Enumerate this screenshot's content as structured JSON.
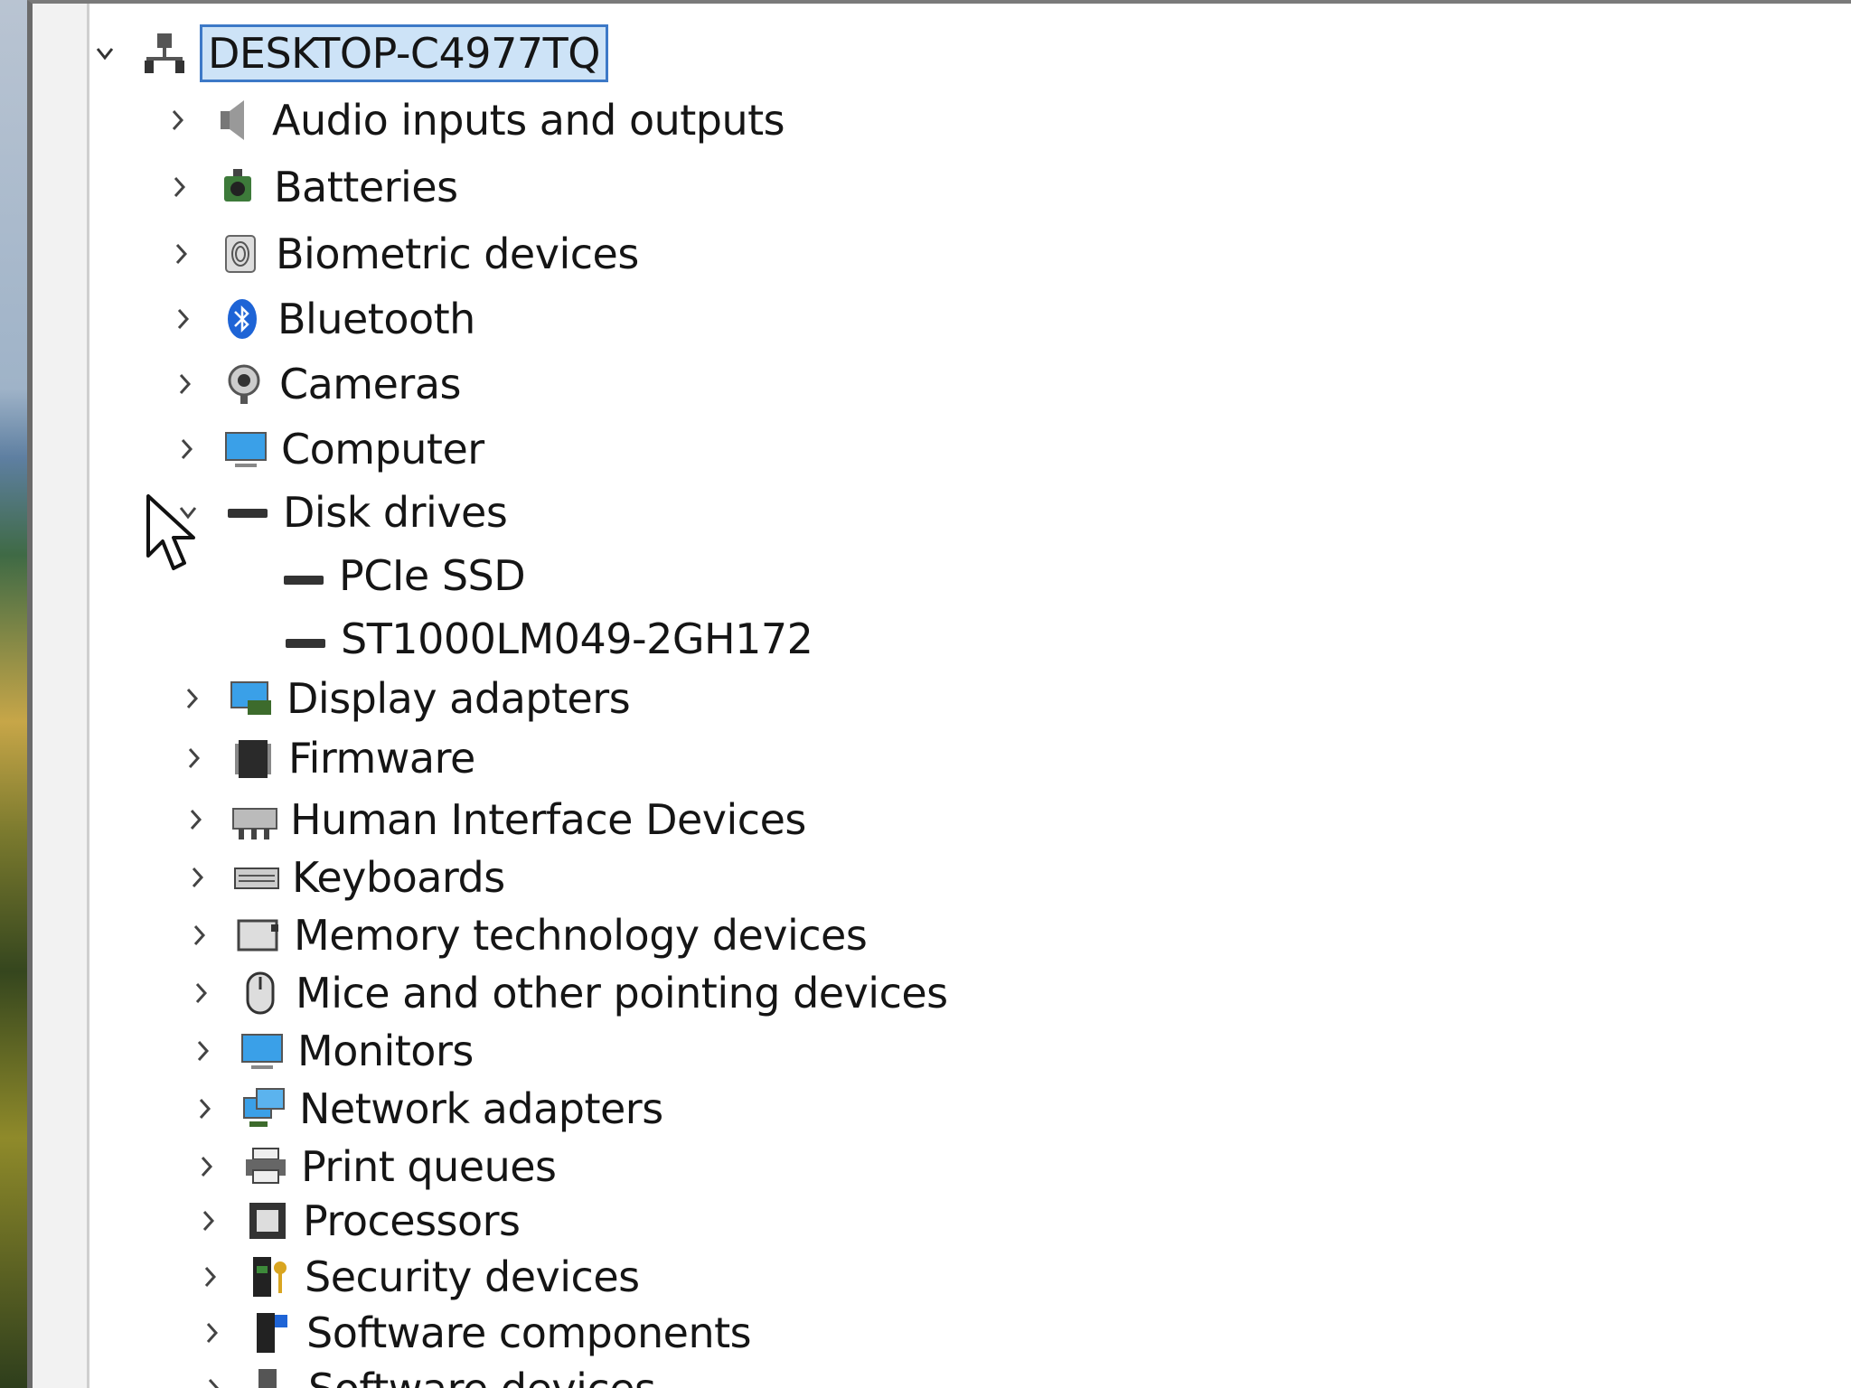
{
  "root": {
    "label": "DESKTOP-C4977TQ",
    "icon": "computer-network-icon"
  },
  "categories": [
    {
      "label": "Audio inputs and outputs",
      "icon": "speaker-icon",
      "expanded": false
    },
    {
      "label": "Batteries",
      "icon": "battery-icon",
      "expanded": false
    },
    {
      "label": "Biometric devices",
      "icon": "fingerprint-icon",
      "expanded": false
    },
    {
      "label": "Bluetooth",
      "icon": "bluetooth-icon",
      "expanded": false
    },
    {
      "label": "Cameras",
      "icon": "webcam-icon",
      "expanded": false
    },
    {
      "label": "Computer",
      "icon": "monitor-icon",
      "expanded": false
    },
    {
      "label": "Disk drives",
      "icon": "disk-drive-icon",
      "expanded": true,
      "children": [
        {
          "label": "PCIe SSD",
          "icon": "disk-drive-icon"
        },
        {
          "label": "ST1000LM049-2GH172",
          "icon": "disk-drive-icon"
        }
      ]
    },
    {
      "label": "Display adapters",
      "icon": "display-adapter-icon",
      "expanded": false
    },
    {
      "label": "Firmware",
      "icon": "firmware-chip-icon",
      "expanded": false
    },
    {
      "label": "Human Interface Devices",
      "icon": "hid-icon",
      "expanded": false
    },
    {
      "label": "Keyboards",
      "icon": "keyboard-icon",
      "expanded": false
    },
    {
      "label": "Memory technology devices",
      "icon": "memory-card-icon",
      "expanded": false
    },
    {
      "label": "Mice and other pointing devices",
      "icon": "mouse-icon",
      "expanded": false
    },
    {
      "label": "Monitors",
      "icon": "monitor-icon",
      "expanded": false
    },
    {
      "label": "Network adapters",
      "icon": "network-adapter-icon",
      "expanded": false
    },
    {
      "label": "Print queues",
      "icon": "printer-icon",
      "expanded": false
    },
    {
      "label": "Processors",
      "icon": "processor-icon",
      "expanded": false
    },
    {
      "label": "Security devices",
      "icon": "security-key-icon",
      "expanded": false
    },
    {
      "label": "Software components",
      "icon": "software-component-icon",
      "expanded": false
    },
    {
      "label": "Software devices",
      "icon": "software-device-icon",
      "expanded": false
    }
  ],
  "colors": {
    "selection_fill": "#cde3f7",
    "selection_border": "#3d79c7",
    "text": "#151515"
  }
}
